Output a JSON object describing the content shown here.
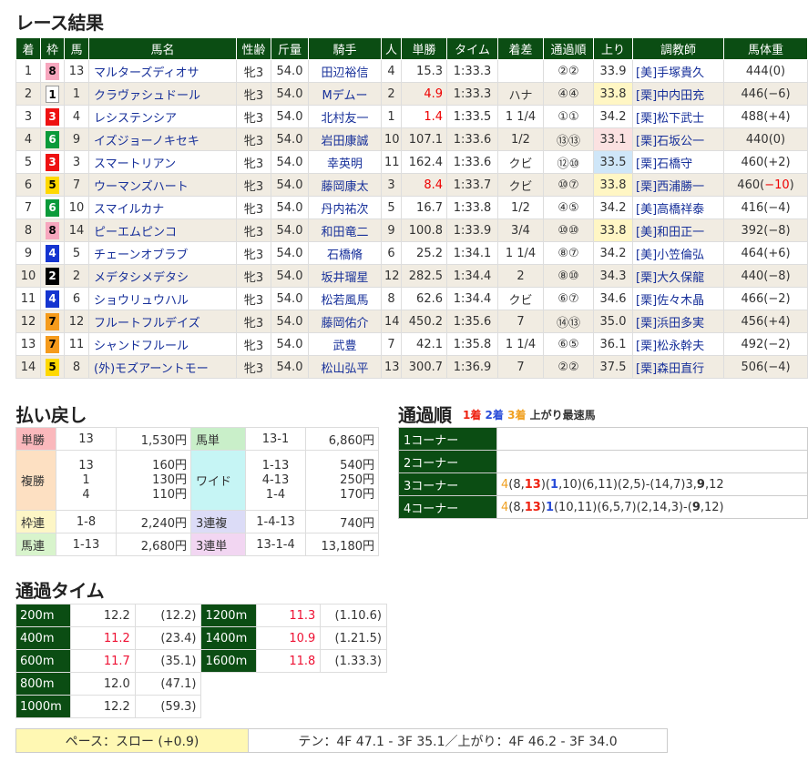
{
  "results": {
    "title": "レース結果",
    "headers": [
      "着",
      "枠",
      "馬",
      "馬名",
      "性齢",
      "斤量",
      "騎手",
      "人",
      "単勝",
      "タイム",
      "着差",
      "通過順",
      "上り",
      "調教師",
      "馬体重"
    ],
    "rows": [
      {
        "pos": "1",
        "waku": "8",
        "num": "13",
        "name": "マルターズディオサ",
        "sexage": "牝3",
        "weight": "54.0",
        "jockey": "田辺裕信",
        "pop": "4",
        "odds": "15.3",
        "time": "1:33.3",
        "margin": "",
        "passing": "②②",
        "last3f": "33.9",
        "trainer": "[美]手塚貴久",
        "bw": "444(0)"
      },
      {
        "pos": "2",
        "waku": "1",
        "num": "1",
        "name": "クラヴァシュドール",
        "sexage": "牝3",
        "weight": "54.0",
        "jockey": "Mデムー",
        "pop": "2",
        "odds": "4.9",
        "time": "1:33.3",
        "margin": "ハナ",
        "passing": "④④",
        "last3f": "33.8",
        "trainer": "[栗]中内田充",
        "bw": "446(−6)"
      },
      {
        "pos": "3",
        "waku": "3",
        "num": "4",
        "name": "レシステンシア",
        "sexage": "牝3",
        "weight": "54.0",
        "jockey": "北村友一",
        "pop": "1",
        "odds": "1.4",
        "time": "1:33.5",
        "margin": "1 1/4",
        "passing": "①①",
        "last3f": "34.2",
        "trainer": "[栗]松下武士",
        "bw": "488(+4)"
      },
      {
        "pos": "4",
        "waku": "6",
        "num": "9",
        "name": "イズジョーノキセキ",
        "sexage": "牝3",
        "weight": "54.0",
        "jockey": "岩田康誠",
        "pop": "10",
        "odds": "107.1",
        "time": "1:33.6",
        "margin": "1/2",
        "passing": "⑬⑬",
        "last3f": "33.1",
        "trainer": "[栗]石坂公一",
        "bw": "440(0)"
      },
      {
        "pos": "5",
        "waku": "3",
        "num": "3",
        "name": "スマートリアン",
        "sexage": "牝3",
        "weight": "54.0",
        "jockey": "幸英明",
        "pop": "11",
        "odds": "162.4",
        "time": "1:33.6",
        "margin": "クビ",
        "passing": "⑫⑩",
        "last3f": "33.5",
        "trainer": "[栗]石橋守",
        "bw": "460(+2)"
      },
      {
        "pos": "6",
        "waku": "5",
        "num": "7",
        "name": "ウーマンズハート",
        "sexage": "牝3",
        "weight": "54.0",
        "jockey": "藤岡康太",
        "pop": "3",
        "odds": "8.4",
        "time": "1:33.7",
        "margin": "クビ",
        "passing": "⑩⑦",
        "last3f": "33.8",
        "trainer": "[栗]西浦勝一",
        "bw": "460(−10)"
      },
      {
        "pos": "7",
        "waku": "6",
        "num": "10",
        "name": "スマイルカナ",
        "sexage": "牝3",
        "weight": "54.0",
        "jockey": "丹内祐次",
        "pop": "5",
        "odds": "16.7",
        "time": "1:33.8",
        "margin": "1/2",
        "passing": "④⑤",
        "last3f": "34.2",
        "trainer": "[美]高橋祥泰",
        "bw": "416(−4)"
      },
      {
        "pos": "8",
        "waku": "8",
        "num": "14",
        "name": "ピーエムピンコ",
        "sexage": "牝3",
        "weight": "54.0",
        "jockey": "和田竜二",
        "pop": "9",
        "odds": "100.8",
        "time": "1:33.9",
        "margin": "3/4",
        "passing": "⑩⑩",
        "last3f": "33.8",
        "trainer": "[美]和田正一",
        "bw": "392(−8)"
      },
      {
        "pos": "9",
        "waku": "4",
        "num": "5",
        "name": "チェーンオブラブ",
        "sexage": "牝3",
        "weight": "54.0",
        "jockey": "石橋脩",
        "pop": "6",
        "odds": "25.2",
        "time": "1:34.1",
        "margin": "1 1/4",
        "passing": "⑧⑦",
        "last3f": "34.2",
        "trainer": "[美]小笠倫弘",
        "bw": "464(+6)"
      },
      {
        "pos": "10",
        "waku": "2",
        "num": "2",
        "name": "メデタシメデタシ",
        "sexage": "牝3",
        "weight": "54.0",
        "jockey": "坂井瑠星",
        "pop": "12",
        "odds": "282.5",
        "time": "1:34.4",
        "margin": "2",
        "passing": "⑧⑩",
        "last3f": "34.3",
        "trainer": "[栗]大久保龍",
        "bw": "440(−8)"
      },
      {
        "pos": "11",
        "waku": "4",
        "num": "6",
        "name": "ショウリュウハル",
        "sexage": "牝3",
        "weight": "54.0",
        "jockey": "松若風馬",
        "pop": "8",
        "odds": "62.6",
        "time": "1:34.4",
        "margin": "クビ",
        "passing": "⑥⑦",
        "last3f": "34.6",
        "trainer": "[栗]佐々木晶",
        "bw": "466(−2)"
      },
      {
        "pos": "12",
        "waku": "7",
        "num": "12",
        "name": "フルートフルデイズ",
        "sexage": "牝3",
        "weight": "54.0",
        "jockey": "藤岡佑介",
        "pop": "14",
        "odds": "450.2",
        "time": "1:35.6",
        "margin": "7",
        "passing": "⑭⑬",
        "last3f": "35.0",
        "trainer": "[栗]浜田多実",
        "bw": "456(+4)"
      },
      {
        "pos": "13",
        "waku": "7",
        "num": "11",
        "name": "シャンドフルール",
        "sexage": "牝3",
        "weight": "54.0",
        "jockey": "武豊",
        "pop": "7",
        "odds": "42.1",
        "time": "1:35.8",
        "margin": "1 1/4",
        "passing": "⑥⑤",
        "last3f": "36.1",
        "trainer": "[栗]松永幹夫",
        "bw": "492(−2)"
      },
      {
        "pos": "14",
        "waku": "5",
        "num": "8",
        "name": "(外)モズアーントモー",
        "sexage": "牝3",
        "weight": "54.0",
        "jockey": "松山弘平",
        "pop": "13",
        "odds": "300.7",
        "time": "1:36.9",
        "margin": "7",
        "passing": "②②",
        "last3f": "37.5",
        "trainer": "[栗]森田直行",
        "bw": "506(−4)"
      }
    ]
  },
  "payout": {
    "title": "払い戻し",
    "tansho": {
      "label": "単勝",
      "nums": [
        "13"
      ],
      "yen": [
        "1,530円"
      ]
    },
    "fukusho": {
      "label": "複勝",
      "nums": [
        "13",
        "1",
        "4"
      ],
      "yen": [
        "160円",
        "130円",
        "110円"
      ]
    },
    "wakuren": {
      "label": "枠連",
      "nums": [
        "1-8"
      ],
      "yen": [
        "2,240円"
      ]
    },
    "umaren": {
      "label": "馬連",
      "nums": [
        "1-13"
      ],
      "yen": [
        "2,680円"
      ]
    },
    "umatan": {
      "label": "馬単",
      "nums": [
        "13-1"
      ],
      "yen": [
        "6,860円"
      ]
    },
    "wide": {
      "label": "ワイド",
      "nums": [
        "1-13",
        "4-13",
        "1-4"
      ],
      "yen": [
        "540円",
        "250円",
        "170円"
      ]
    },
    "sanrenpuku": {
      "label": "3連複",
      "nums": [
        "1-4-13"
      ],
      "yen": [
        "740円"
      ]
    },
    "sanrentan": {
      "label": "3連単",
      "nums": [
        "13-1-4"
      ],
      "yen": [
        "13,180円"
      ]
    }
  },
  "passing_order": {
    "title": "通過順",
    "legend": {
      "first": "1着",
      "second": "2着",
      "third": "3着",
      "fastest": "上がり最速馬"
    },
    "corners": [
      {
        "label": "1コーナー",
        "order": ""
      },
      {
        "label": "2コーナー",
        "order": ""
      },
      {
        "label": "3コーナー",
        "order": "4(8,13)(1,10)(6,11)(2,5)-(14,7)3,9,12"
      },
      {
        "label": "4コーナー",
        "order": "4(8,13)1(10,11)(6,5,7)(2,14,3)-(9,12)"
      }
    ]
  },
  "lap_times": {
    "title": "通過タイム",
    "rows": [
      {
        "dist": "200m",
        "lap": "12.2",
        "cum": "(12.2)"
      },
      {
        "dist": "400m",
        "lap": "11.2",
        "cum": "(23.4)"
      },
      {
        "dist": "600m",
        "lap": "11.7",
        "cum": "(35.1)"
      },
      {
        "dist": "800m",
        "lap": "12.0",
        "cum": "(47.1)"
      },
      {
        "dist": "1000m",
        "lap": "12.2",
        "cum": "(59.3)"
      },
      {
        "dist": "1200m",
        "lap": "11.3",
        "cum": "(1.10.6)"
      },
      {
        "dist": "1400m",
        "lap": "10.9",
        "cum": "(1.21.5)"
      },
      {
        "dist": "1600m",
        "lap": "11.8",
        "cum": "(1.33.3)"
      }
    ]
  },
  "pace": {
    "label": "ペース：スロー (+0.9)",
    "summary": "テン：4F 47.1 - 3F 35.1／上がり：4F 46.2 - 3F 34.0"
  },
  "colors": {
    "header_green": "#0b4d13",
    "accent_red": "#e00",
    "link_blue": "#17309a"
  }
}
